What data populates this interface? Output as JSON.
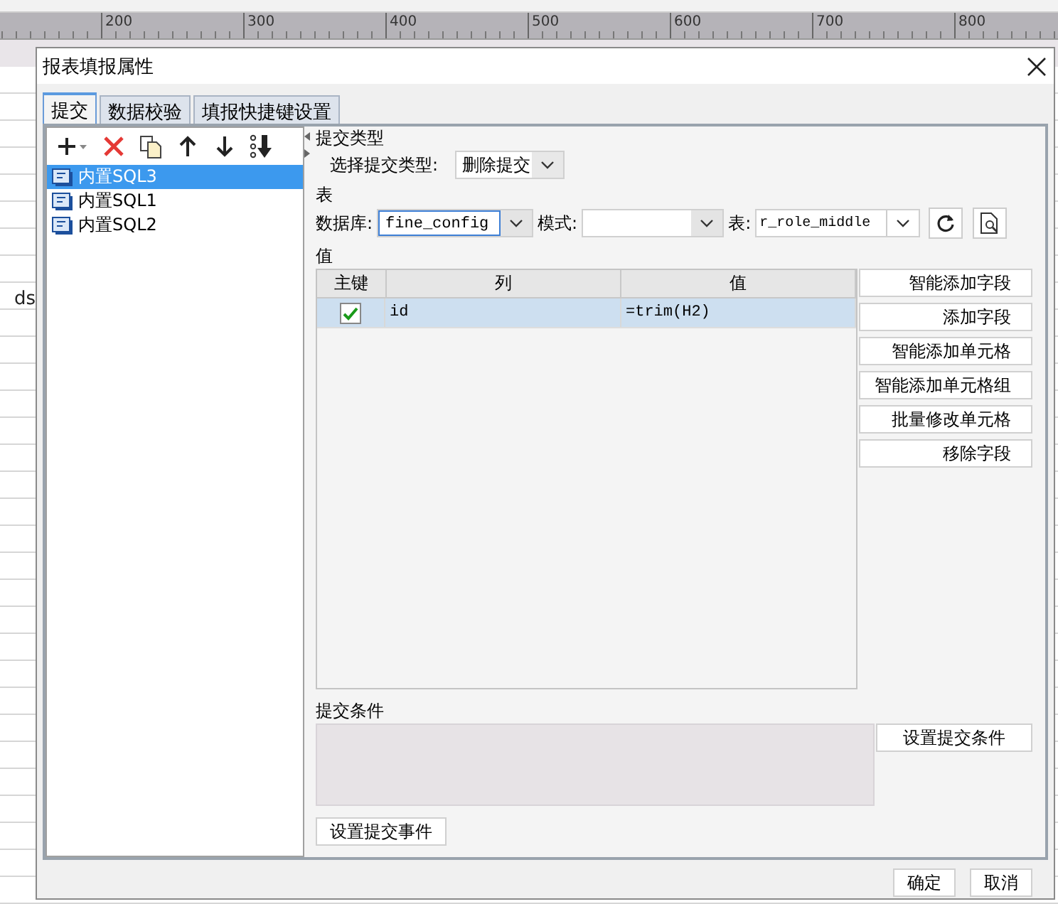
{
  "background": {
    "ruler_labels": [
      "200",
      "300",
      "400",
      "500",
      "600",
      "700",
      "800"
    ],
    "cell_text": "ds"
  },
  "dialog": {
    "title": "报表填报属性",
    "tabs": [
      {
        "label": "提交",
        "selected": true
      },
      {
        "label": "数据校验",
        "selected": false
      },
      {
        "label": "填报快捷键设置",
        "selected": false
      }
    ],
    "items": [
      {
        "label": "内置SQL3",
        "selected": true
      },
      {
        "label": "内置SQL1",
        "selected": false
      },
      {
        "label": "内置SQL2",
        "selected": false
      }
    ],
    "submit_type": {
      "heading": "提交类型",
      "label": "选择提交类型:",
      "value": "删除提交"
    },
    "table_section": {
      "heading": "表",
      "database": {
        "label": "数据库:",
        "value": "fine_config"
      },
      "schema": {
        "label": "模式:"
      },
      "table": {
        "label": "表:",
        "value": "r_role_middle"
      }
    },
    "values": {
      "heading": "值",
      "columns": [
        "主键",
        "列",
        "值"
      ],
      "rows": [
        {
          "primary_key": true,
          "column": "id",
          "value": "=trim(H2)",
          "selected": true
        }
      ],
      "buttons": [
        "智能添加字段",
        "添加字段",
        "智能添加单元格",
        "智能添加单元格组",
        "批量修改单元格",
        "移除字段"
      ]
    },
    "condition": {
      "heading": "提交条件",
      "button": "设置提交条件"
    },
    "event_button": "设置提交事件",
    "footer_buttons": [
      "确定",
      "取消"
    ]
  }
}
